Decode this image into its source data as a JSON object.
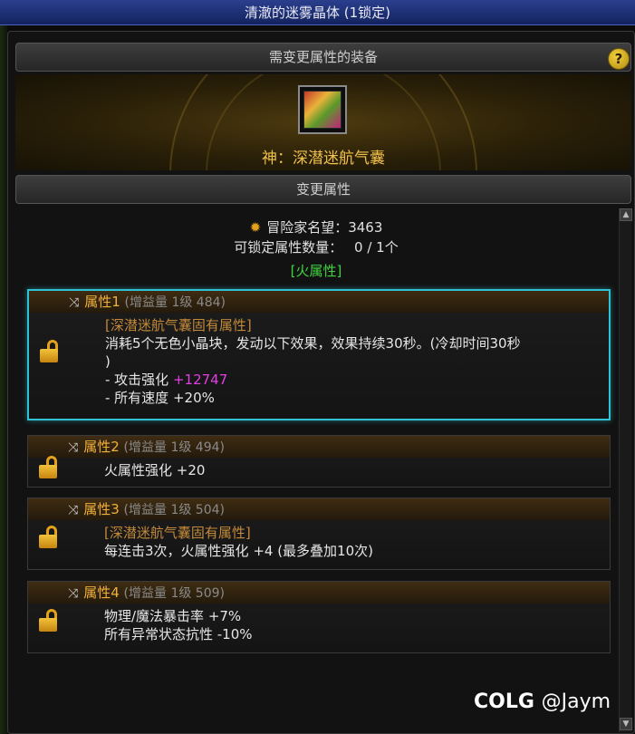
{
  "window_title": "清澈的迷雾晶体 (1锁定)",
  "equip_section_title": "需变更属性的装备",
  "help_label": "?",
  "equipment": {
    "name": "神：深潜迷航气囊",
    "icon": "item-airbag-icon"
  },
  "change_section_title": "变更属性",
  "fame": {
    "label": "冒险家名望：3463",
    "icon": "fame-star-icon"
  },
  "lockable": {
    "label": "可锁定属性数量：",
    "value": "0 / 1个"
  },
  "element_tag": "[火属性]",
  "properties": [
    {
      "title": "属性1",
      "sub": "(增益量 1级 484)",
      "tag": "[深潜迷航气囊固有属性]",
      "lines": [
        "消耗5个无色小晶块，发动以下效果，效果持续30秒。(冷却时间30秒",
        ")"
      ],
      "stats": [
        {
          "label": "- 攻击强化",
          "value": "+12747"
        },
        {
          "label": "- 所有速度",
          "value": "+20%"
        }
      ],
      "selected": true
    },
    {
      "title": "属性2",
      "sub": "(增益量 1级 494)",
      "lines": [
        "火属性强化 +20"
      ]
    },
    {
      "title": "属性3",
      "sub": "(增益量 1级 504)",
      "tag": "[深潜迷航气囊固有属性]",
      "lines": [
        "每连击3次，火属性强化 +4 (最多叠加10次)"
      ]
    },
    {
      "title": "属性4",
      "sub": "(增益量 1级 509)",
      "lines": [
        "物理/魔法暴击率 +7%",
        "所有异常状态抗性 -10%"
      ]
    }
  ],
  "watermark": {
    "brand": "COLG",
    "user": "@Jaym"
  },
  "colors": {
    "accent_gold": "#f0b03c",
    "selected_border": "#2fc2d6",
    "element_green": "#3fd53f",
    "highlight_pink": "#e23ee2"
  }
}
